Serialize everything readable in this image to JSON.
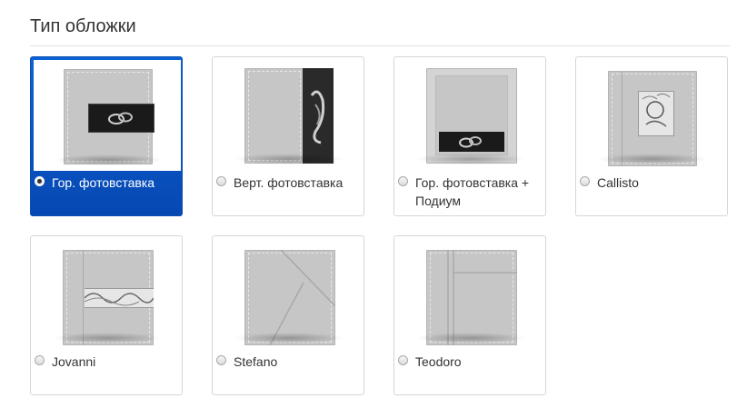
{
  "section": {
    "title": "Тип обложки"
  },
  "options": [
    {
      "label": "Гор. фотовставка",
      "selected": true
    },
    {
      "label": "Верт. фотовставка",
      "selected": false
    },
    {
      "label": "Гор. фотовставка + Подиум",
      "selected": false
    },
    {
      "label": "Callisto",
      "selected": false
    },
    {
      "label": "Jovanni",
      "selected": false
    },
    {
      "label": "Stefano",
      "selected": false
    },
    {
      "label": "Teodoro",
      "selected": false
    }
  ],
  "colors": {
    "selected_bg": "#0a63d6",
    "cover_gray": "#c6c6c6"
  }
}
